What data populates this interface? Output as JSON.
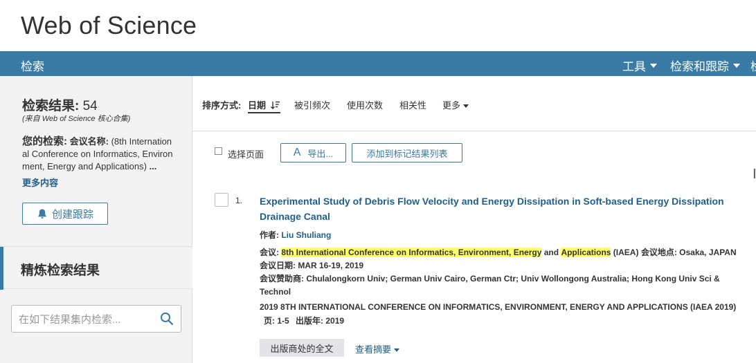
{
  "header": {
    "logo": "Web of Science"
  },
  "nav": {
    "search": "检索",
    "tools": "工具",
    "search_tracking": "检索和跟踪",
    "truncated_item": "检"
  },
  "sidebar": {
    "results_label": "检索结果:",
    "results_count": "54",
    "results_source": "(来自 Web of Science 核心合集)",
    "your_search_label": "您的检索:",
    "your_search_field": "会议名称:",
    "your_search_text": "(8th International Conference on Informatics, Environment, Energy and Applications)",
    "ellipsis": "...",
    "more_link": "更多内容",
    "create_tracking": "创建跟踪",
    "refine_title": "精炼检索结果",
    "search_within_placeholder": "在如下结果集内检索..."
  },
  "sortbar": {
    "label": "排序方式:",
    "date": "日期",
    "times_cited": "被引频次",
    "usage_count": "使用次数",
    "relevance": "相关性",
    "more": "更多"
  },
  "toolbar": {
    "select_page": "选择页面",
    "export": "导出...",
    "add_to_marked": "添加到标记结果列表"
  },
  "record": {
    "number": "1.",
    "title": "Experimental Study of Debris Flow Velocity and Energy Dissipation in Soft-based Energy Dissipation Drainage Canal",
    "author_label": "作者:",
    "author": "Liu Shuliang",
    "conf_label": "会议:",
    "conf_highlight_1": "8th International Conference on Informatics, Environment, Energy",
    "conf_and": "and",
    "conf_highlight_2": "Applications",
    "conf_rest": "(IAEA)",
    "location_label": "会议地点:",
    "location": "Osaka, JAPAN",
    "date_label": "会议日期:",
    "date": "MAR 16-19, 2019",
    "sponsor_label": "会议赞助商:",
    "sponsor": "Chulalongkorn Univ; German Univ Cairo, German Ctr; Univ Wollongong Australia; Hong Kong Univ Sci & Technol",
    "proceedings": "2019 8TH INTERNATIONAL CONFERENCE ON INFORMATICS, ENVIRONMENT, ENERGY AND APPLICATIONS (IAEA 2019)",
    "pages_label": "页:",
    "pages": "1-5",
    "year_label": "出版年:",
    "year": "2019",
    "fulltext_button": "出版商处的全文",
    "view_abstract": "查看摘要"
  },
  "colors": {
    "nav_bg": "#3a7ba6",
    "link": "#1f5e8a",
    "highlight": "#ffff6a",
    "sidebar_bg": "#f3f3f3"
  }
}
